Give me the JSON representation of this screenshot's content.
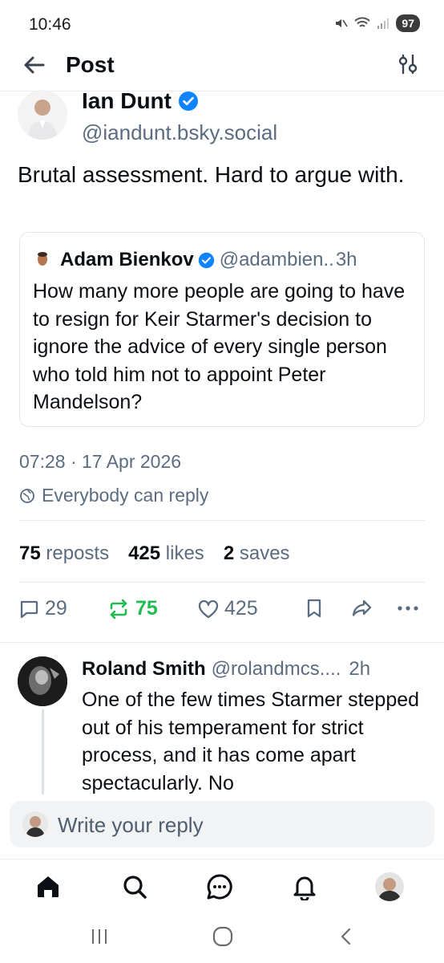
{
  "status_bar": {
    "time": "10:46",
    "battery": "97"
  },
  "header": {
    "title": "Post"
  },
  "post": {
    "author_name": "Ian Dunt",
    "author_handle": "@iandunt.bsky.social",
    "text": "Brutal assessment. Hard to argue with.",
    "quote": {
      "author_name": "Adam Bienkov",
      "author_handle": "@adambien..",
      "time": "3h",
      "text": "How many more people are going to have to resign for Keir Starmer's decision to ignore the advice of every single person who told him not to appoint Peter Mandelson?"
    },
    "timestamp": "07:28 · 17 Apr 2026",
    "reply_permission": "Everybody can reply",
    "stats": {
      "reposts_count": "75",
      "reposts_label": "reposts",
      "likes_count": "425",
      "likes_label": "likes",
      "saves_count": "2",
      "saves_label": "saves"
    },
    "actions": {
      "replies": "29",
      "reposts": "75",
      "likes": "425"
    }
  },
  "reply": {
    "author_name": "Roland Smith",
    "author_handle": "@rolandmcs....",
    "time": "2h",
    "text": "One of the few times Starmer stepped out of his temperament for strict process, and it has come apart spectacularly. No"
  },
  "composer": {
    "placeholder": "Write your reply"
  },
  "colors": {
    "accent": "#1083fe",
    "repost_active": "#20bc52",
    "muted": "#5b6b80"
  },
  "icons": [
    "back-arrow-icon",
    "filter-icon",
    "verified-badge-icon",
    "globe-icon",
    "reply-icon",
    "repost-icon",
    "heart-icon",
    "bookmark-icon",
    "share-icon",
    "more-icon",
    "home-icon",
    "search-icon",
    "chat-icon",
    "bell-icon",
    "recents-icon",
    "home-circle-icon",
    "back-icon"
  ]
}
